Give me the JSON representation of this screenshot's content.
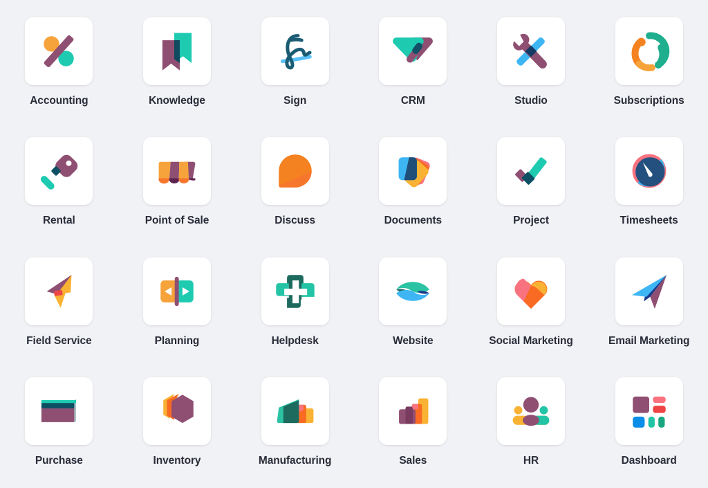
{
  "page": {
    "background_color": "#f1f2f5",
    "tile_color": "#ffffff",
    "label_color": "#2a2c39",
    "columns": 6,
    "rows": 4
  },
  "palette": {
    "purple": "#8f4f72",
    "purple_dark": "#714b67",
    "teal": "#1ecbb1",
    "teal_dark": "#1d6a5f",
    "green": "#21b799",
    "orange": "#f6a33c",
    "orange_deep": "#f6772c",
    "orange_bright": "#f97316",
    "yellow": "#f9b233",
    "blue": "#38b6f1",
    "blue_dark": "#17486b",
    "navy": "#1f3f6b",
    "navy_deep": "#1b3a8c",
    "coral": "#f8737f",
    "red": "#ef4444",
    "sky": "#0b8ee8",
    "ink": "#0d4f63"
  },
  "apps": [
    {
      "name": "Accounting",
      "icon": "accounting-icon"
    },
    {
      "name": "Knowledge",
      "icon": "knowledge-icon"
    },
    {
      "name": "Sign",
      "icon": "sign-icon"
    },
    {
      "name": "CRM",
      "icon": "crm-icon"
    },
    {
      "name": "Studio",
      "icon": "studio-icon"
    },
    {
      "name": "Subscriptions",
      "icon": "subscriptions-icon"
    },
    {
      "name": "Rental",
      "icon": "rental-icon"
    },
    {
      "name": "Point of Sale",
      "icon": "point-of-sale-icon"
    },
    {
      "name": "Discuss",
      "icon": "discuss-icon"
    },
    {
      "name": "Documents",
      "icon": "documents-icon"
    },
    {
      "name": "Project",
      "icon": "project-icon"
    },
    {
      "name": "Timesheets",
      "icon": "timesheets-icon"
    },
    {
      "name": "Field Service",
      "icon": "field-service-icon"
    },
    {
      "name": "Planning",
      "icon": "planning-icon"
    },
    {
      "name": "Helpdesk",
      "icon": "helpdesk-icon"
    },
    {
      "name": "Website",
      "icon": "website-icon"
    },
    {
      "name": "Social Marketing",
      "icon": "social-marketing-icon"
    },
    {
      "name": "Email Marketing",
      "icon": "email-marketing-icon"
    },
    {
      "name": "Purchase",
      "icon": "purchase-icon"
    },
    {
      "name": "Inventory",
      "icon": "inventory-icon"
    },
    {
      "name": "Manufacturing",
      "icon": "manufacturing-icon"
    },
    {
      "name": "Sales",
      "icon": "sales-icon"
    },
    {
      "name": "HR",
      "icon": "hr-icon"
    },
    {
      "name": "Dashboard",
      "icon": "dashboard-icon"
    }
  ]
}
